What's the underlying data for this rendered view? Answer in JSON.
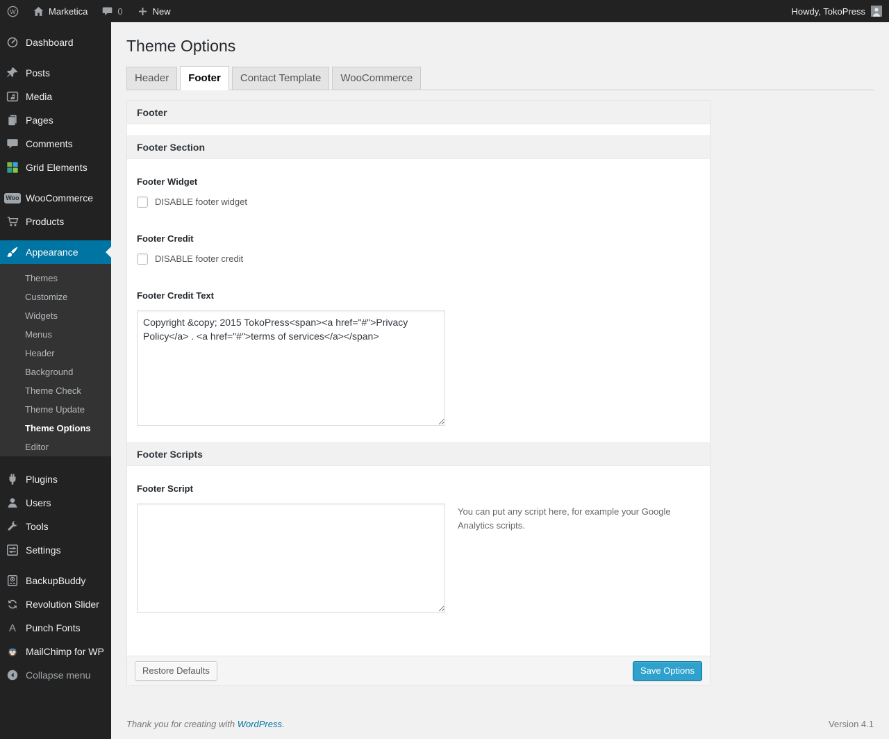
{
  "admin_bar": {
    "wp_logo_letter": "W",
    "site_name": "Marketica",
    "comments_count": "0",
    "new_label": "New",
    "howdy": "Howdy, TokoPress"
  },
  "sidebar": {
    "items": [
      {
        "label": "Dashboard"
      },
      {
        "label": "Posts"
      },
      {
        "label": "Media"
      },
      {
        "label": "Pages"
      },
      {
        "label": "Comments"
      },
      {
        "label": "Grid Elements"
      },
      {
        "label": "WooCommerce"
      },
      {
        "label": "Products"
      },
      {
        "label": "Appearance"
      },
      {
        "label": "Plugins"
      },
      {
        "label": "Users"
      },
      {
        "label": "Tools"
      },
      {
        "label": "Settings"
      },
      {
        "label": "BackupBuddy"
      },
      {
        "label": "Revolution Slider"
      },
      {
        "label": "Punch Fonts"
      },
      {
        "label": "MailChimp for WP"
      },
      {
        "label": "Collapse menu"
      }
    ],
    "woo_badge": "Woo",
    "punch_fonts_glyph": "A",
    "appearance_submenu": [
      {
        "label": "Themes"
      },
      {
        "label": "Customize"
      },
      {
        "label": "Widgets"
      },
      {
        "label": "Menus"
      },
      {
        "label": "Header"
      },
      {
        "label": "Background"
      },
      {
        "label": "Theme Check"
      },
      {
        "label": "Theme Update"
      },
      {
        "label": "Theme Options",
        "current": true
      },
      {
        "label": "Editor"
      }
    ]
  },
  "page": {
    "title": "Theme Options",
    "tabs": [
      {
        "label": "Header",
        "active": false
      },
      {
        "label": "Footer",
        "active": true
      },
      {
        "label": "Contact Template",
        "active": false
      },
      {
        "label": "WooCommerce",
        "active": false
      }
    ]
  },
  "panel": {
    "title": "Footer",
    "section_title": "Footer Section",
    "footer_widget": {
      "label": "Footer Widget",
      "checkbox_label": "DISABLE footer widget",
      "checked": false
    },
    "footer_credit": {
      "label": "Footer Credit",
      "checkbox_label": "DISABLE footer credit",
      "checked": false
    },
    "footer_credit_text": {
      "label": "Footer Credit Text",
      "value": "Copyright &copy; 2015 TokoPress<span><a href=\"#\">Privacy Policy</a> . <a href=\"#\">terms of services</a></span>"
    },
    "scripts_section_title": "Footer Scripts",
    "footer_script": {
      "label": "Footer Script",
      "value": "",
      "description": "You can put any script here, for example your Google Analytics scripts."
    },
    "actions": {
      "restore_label": "Restore Defaults",
      "save_label": "Save Options"
    }
  },
  "footer": {
    "thanks_text": "Thank you for creating with ",
    "wordpress_link": "WordPress",
    "suffix": ".",
    "version": "Version 4.1"
  },
  "colors": {
    "accent_blue": "#0074a2",
    "button_primary": "#2ea2cc",
    "admin_dark": "#222222",
    "page_bg": "#f1f1f1"
  }
}
